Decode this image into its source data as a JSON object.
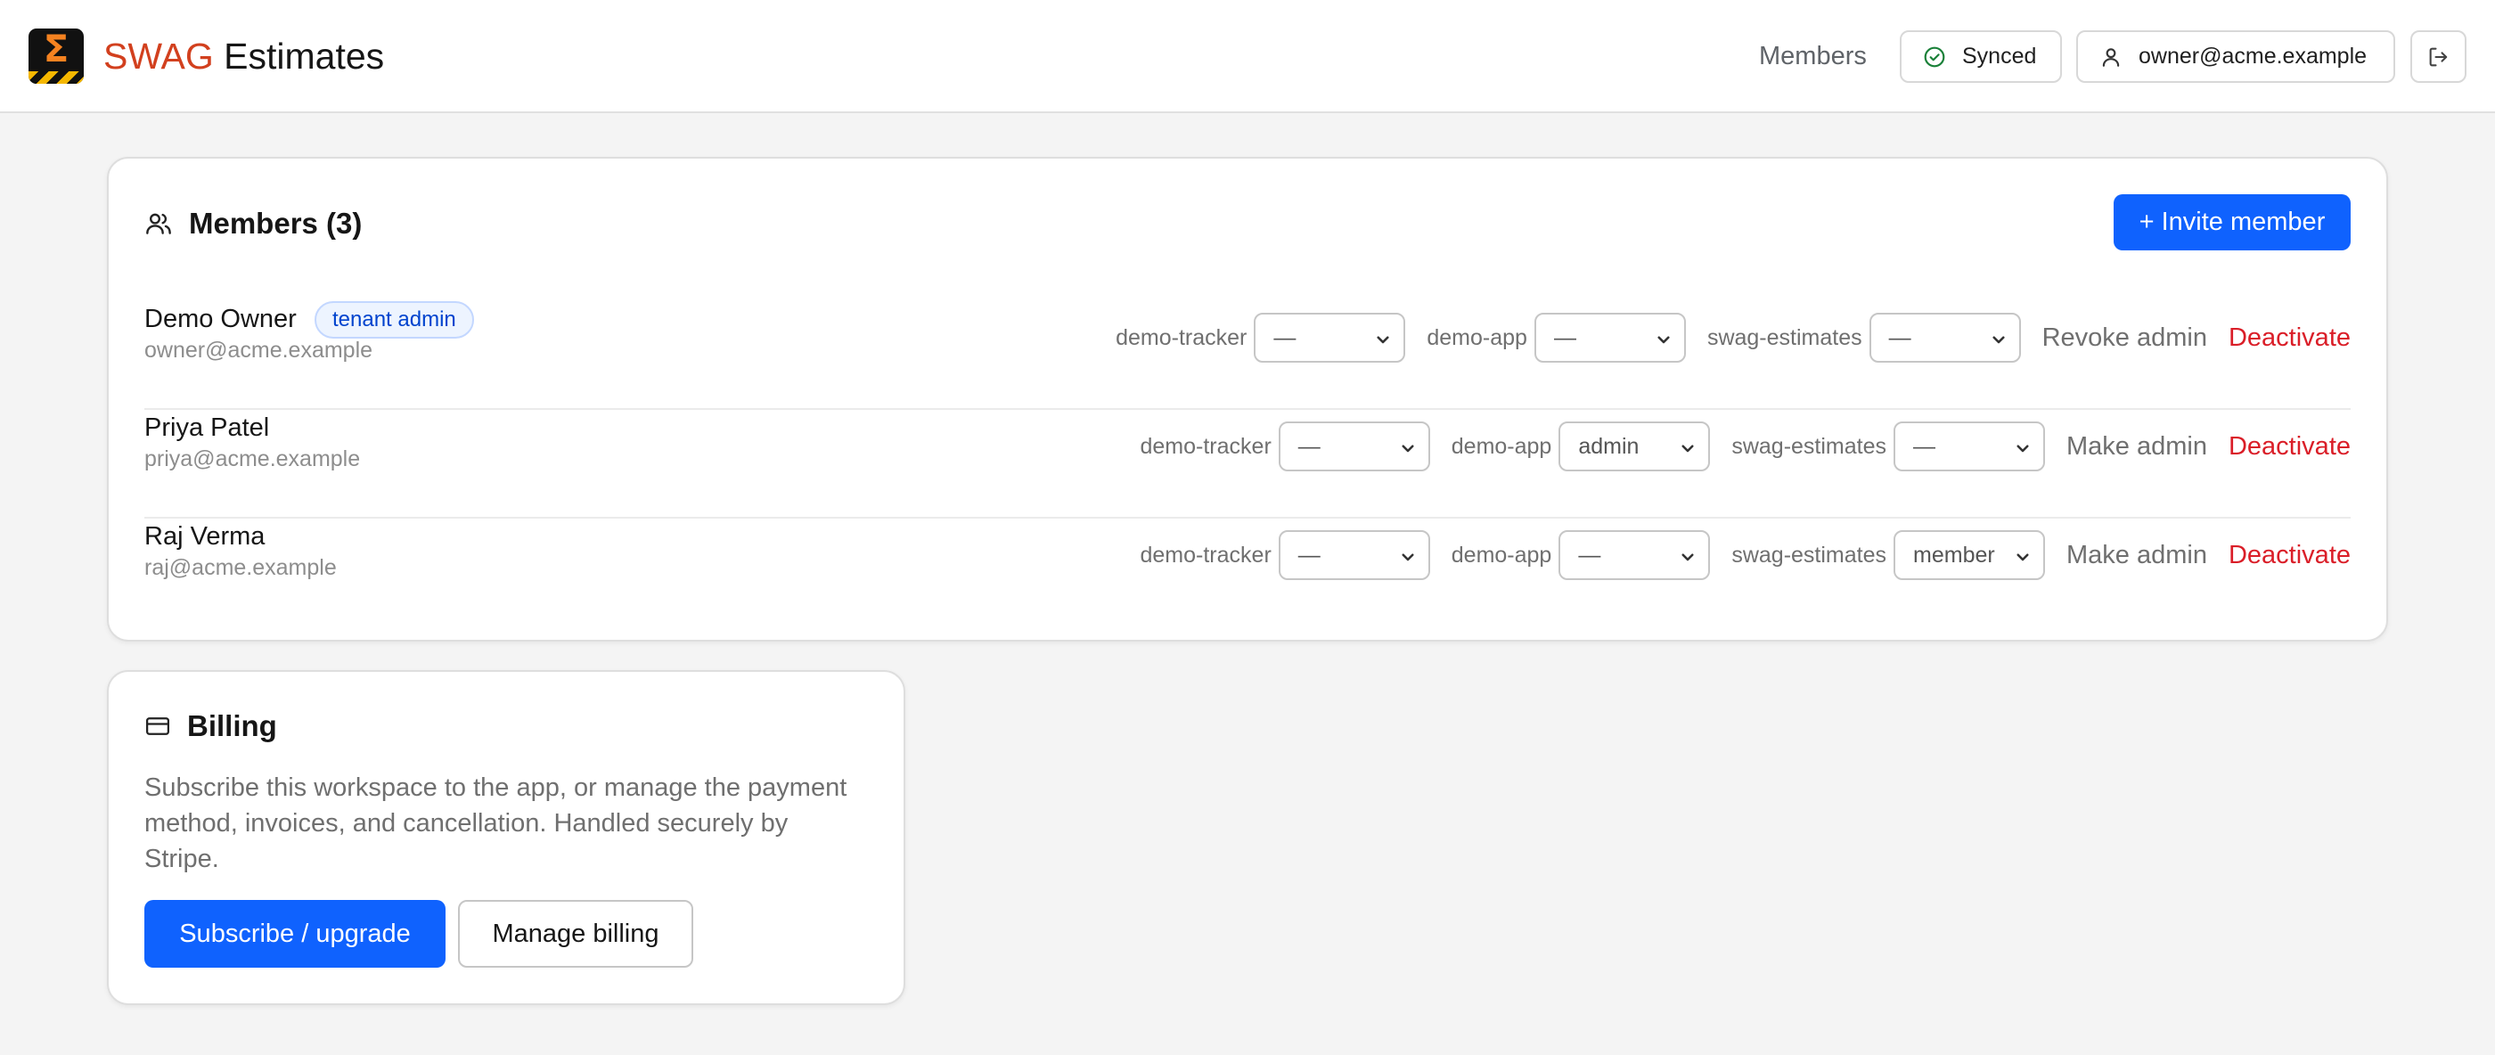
{
  "header": {
    "brand_accent": "SWAG",
    "brand_rest": "Estimates",
    "nav_members": "Members",
    "sync_status": "Synced",
    "user_email": "owner@acme.example"
  },
  "members_card": {
    "title": "Members (3)",
    "invite_label": "+ Invite member",
    "members": [
      {
        "name": "Demo Owner",
        "badge": "tenant admin",
        "email": "owner@acme.example",
        "apps": [
          {
            "label": "demo-tracker",
            "value": "—"
          },
          {
            "label": "demo-app",
            "value": "—"
          },
          {
            "label": "swag-estimates",
            "value": "—"
          }
        ],
        "admin_action": "Revoke admin",
        "deactivate": "Deactivate"
      },
      {
        "name": "Priya Patel",
        "email": "priya@acme.example",
        "apps": [
          {
            "label": "demo-tracker",
            "value": "—"
          },
          {
            "label": "demo-app",
            "value": "admin"
          },
          {
            "label": "swag-estimates",
            "value": "—"
          }
        ],
        "admin_action": "Make admin",
        "deactivate": "Deactivate"
      },
      {
        "name": "Raj Verma",
        "email": "raj@acme.example",
        "apps": [
          {
            "label": "demo-tracker",
            "value": "—"
          },
          {
            "label": "demo-app",
            "value": "—"
          },
          {
            "label": "swag-estimates",
            "value": "member"
          }
        ],
        "admin_action": "Make admin",
        "deactivate": "Deactivate"
      }
    ]
  },
  "billing_card": {
    "title": "Billing",
    "description": "Subscribe this workspace to the app, or manage the payment method, invoices, and cancellation. Handled securely by Stripe.",
    "subscribe_label": "Subscribe / upgrade",
    "manage_label": "Manage billing"
  },
  "colors": {
    "primary": "#0f62fe",
    "brand_accent": "#d2401e",
    "danger": "#da1e28",
    "synced": "#198038"
  }
}
